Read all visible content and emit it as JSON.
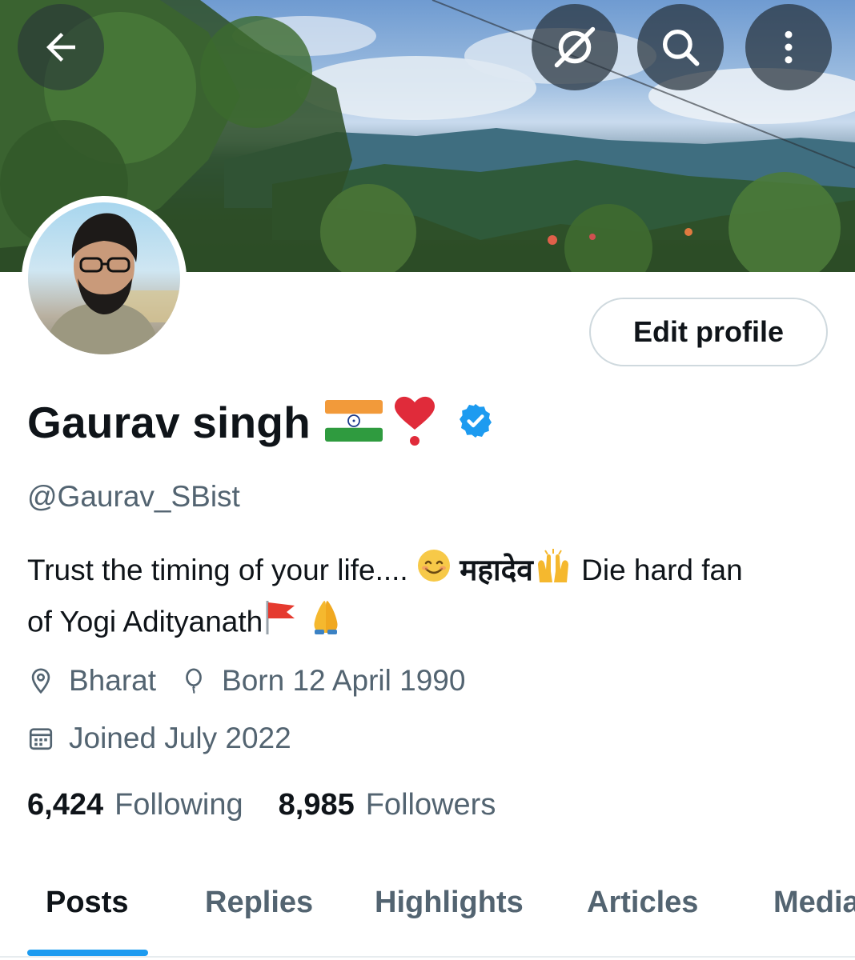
{
  "profile": {
    "name": "Gaurav singh",
    "handle": "@Gaurav_SBist",
    "verified": true,
    "bio_prefix": "Trust the timing of your life....",
    "bio_devanagari": "महादेव",
    "bio_middle": "Die hard fan",
    "bio_line2": "of Yogi Adityanath",
    "location": "Bharat",
    "birth": "Born 12 April 1990",
    "joined": "Joined July 2022"
  },
  "stats": {
    "following_count": "6,424",
    "following_label": "Following",
    "followers_count": "8,985",
    "followers_label": "Followers"
  },
  "actions": {
    "edit_profile": "Edit profile"
  },
  "tabs": [
    {
      "label": "Posts",
      "active": true
    },
    {
      "label": "Replies",
      "active": false
    },
    {
      "label": "Highlights",
      "active": false
    },
    {
      "label": "Articles",
      "active": false
    },
    {
      "label": "Media",
      "active": false
    }
  ],
  "icons": {
    "back": "arrow-left-icon",
    "grok": "grok-icon",
    "search": "search-icon",
    "more": "more-vertical-icon",
    "verified": "verified-badge-icon",
    "location": "location-pin-icon",
    "birthday": "balloon-icon",
    "calendar": "calendar-icon"
  },
  "colors": {
    "accent": "#1d9bf0",
    "text_primary": "#0f1419",
    "text_secondary": "#536471"
  }
}
